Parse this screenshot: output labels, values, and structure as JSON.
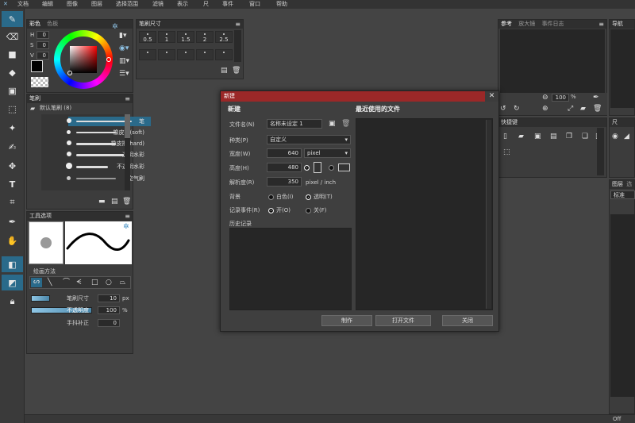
{
  "menubar": {
    "logo": "✕",
    "items": [
      "文档",
      "编辑",
      "图像",
      "图层",
      "选择范围",
      "滤镜",
      "表示",
      "尺",
      "事件",
      "窗口",
      "帮助"
    ]
  },
  "color_panel": {
    "tabs": [
      "彩色",
      "色板"
    ],
    "hsv_labels": [
      "H",
      "S",
      "V"
    ],
    "hsv_values": [
      "0",
      "0",
      "0"
    ],
    "primary_color": "#000000",
    "secondary_color": "#ffffff"
  },
  "brush_size_panel": {
    "title": "笔刷尺寸",
    "sizes": [
      "0.5",
      "1",
      "1.5",
      "2",
      "2.5"
    ]
  },
  "brush_panel": {
    "title": "笔刷",
    "group": "默认笔刷 (8)",
    "items": [
      "笔",
      "橡皮擦(soft)",
      "橡皮擦(hard)",
      "透明水彩",
      "不透明水彩",
      "空气刷"
    ]
  },
  "tool_options": {
    "title": "工具选项",
    "draw_method_label": "绘画方法",
    "brush_size_label": "笔刷尺寸",
    "brush_size_value": "10",
    "brush_size_unit": "px",
    "opacity_label": "不透明度",
    "opacity_value": "100",
    "opacity_unit": "%",
    "stabilizer_label": "手抖补正",
    "stabilizer_value": "0"
  },
  "right_panels": {
    "reference_tabs": [
      "参考",
      "放大镜",
      "事件日志"
    ],
    "zoom_value": "100",
    "zoom_unit": "%",
    "shortcut_title": "快捷键",
    "nav_title": "导航",
    "ruler_title": "尺",
    "layer_title": "图层",
    "layer_extra": "选",
    "layer_mode": "标准",
    "status_off": "Off"
  },
  "dialog": {
    "title": "新建",
    "section_title": "新建",
    "recent_title": "最近使用的文件",
    "filename_label": "文件名(N)",
    "filename_value": "名称未设定 1",
    "type_label": "种类(P)",
    "type_value": "自定义",
    "width_label": "宽度(W)",
    "width_value": "640",
    "unit_value": "pixel",
    "height_label": "高度(H)",
    "height_value": "480",
    "resolution_label": "解析度(R)",
    "resolution_value": "350",
    "resolution_unit": "pixel / inch",
    "background_label": "背景",
    "bg_white": "白色(I)",
    "bg_transparent": "透明(T)",
    "record_label": "记录事件(R)",
    "record_on": "开(O)",
    "record_off": "关(F)",
    "history_label": "历史记录",
    "create_button": "制作",
    "open_button": "打开文件",
    "close_button": "关闭",
    "accent_color": "#9b2828"
  }
}
